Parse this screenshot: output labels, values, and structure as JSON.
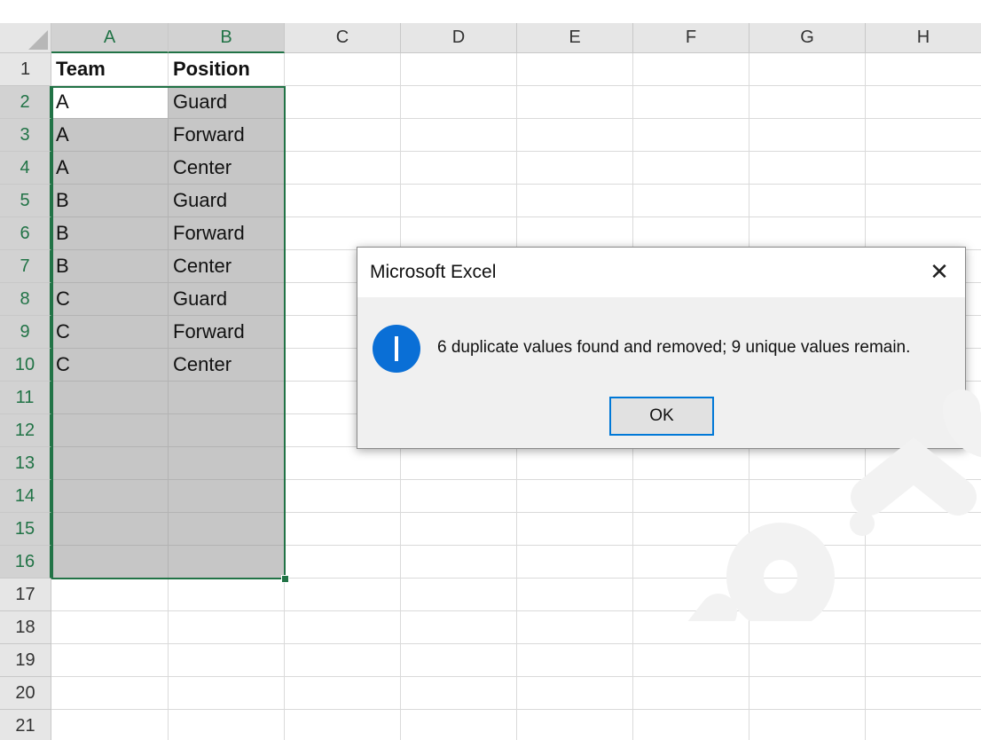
{
  "sheet": {
    "columns": [
      "A",
      "B",
      "C",
      "D",
      "E",
      "F",
      "G",
      "H"
    ],
    "rows": [
      "1",
      "2",
      "3",
      "4",
      "5",
      "6",
      "7",
      "8",
      "9",
      "10",
      "11",
      "12",
      "13",
      "14",
      "15",
      "16",
      "17",
      "18",
      "19",
      "20",
      "21"
    ],
    "cells": [
      [
        "Team",
        "Position"
      ],
      [
        "A",
        "Guard"
      ],
      [
        "A",
        "Forward"
      ],
      [
        "A",
        "Center"
      ],
      [
        "B",
        "Guard"
      ],
      [
        "B",
        "Forward"
      ],
      [
        "B",
        "Center"
      ],
      [
        "C",
        "Guard"
      ],
      [
        "C",
        "Forward"
      ],
      [
        "C",
        "Center"
      ]
    ],
    "selection": {
      "range": "A2:B16",
      "active_cell": "A2"
    }
  },
  "dialog": {
    "title": "Microsoft Excel",
    "close_glyph": "✕",
    "icon": "info-icon",
    "message": "6 duplicate values found and removed; 9 unique values remain.",
    "ok_label": "OK"
  },
  "colors": {
    "excel_green": "#217346",
    "selection_fill": "#c6c6c6",
    "info_blue": "#0a6fd6",
    "button_focus": "#0078d7"
  }
}
